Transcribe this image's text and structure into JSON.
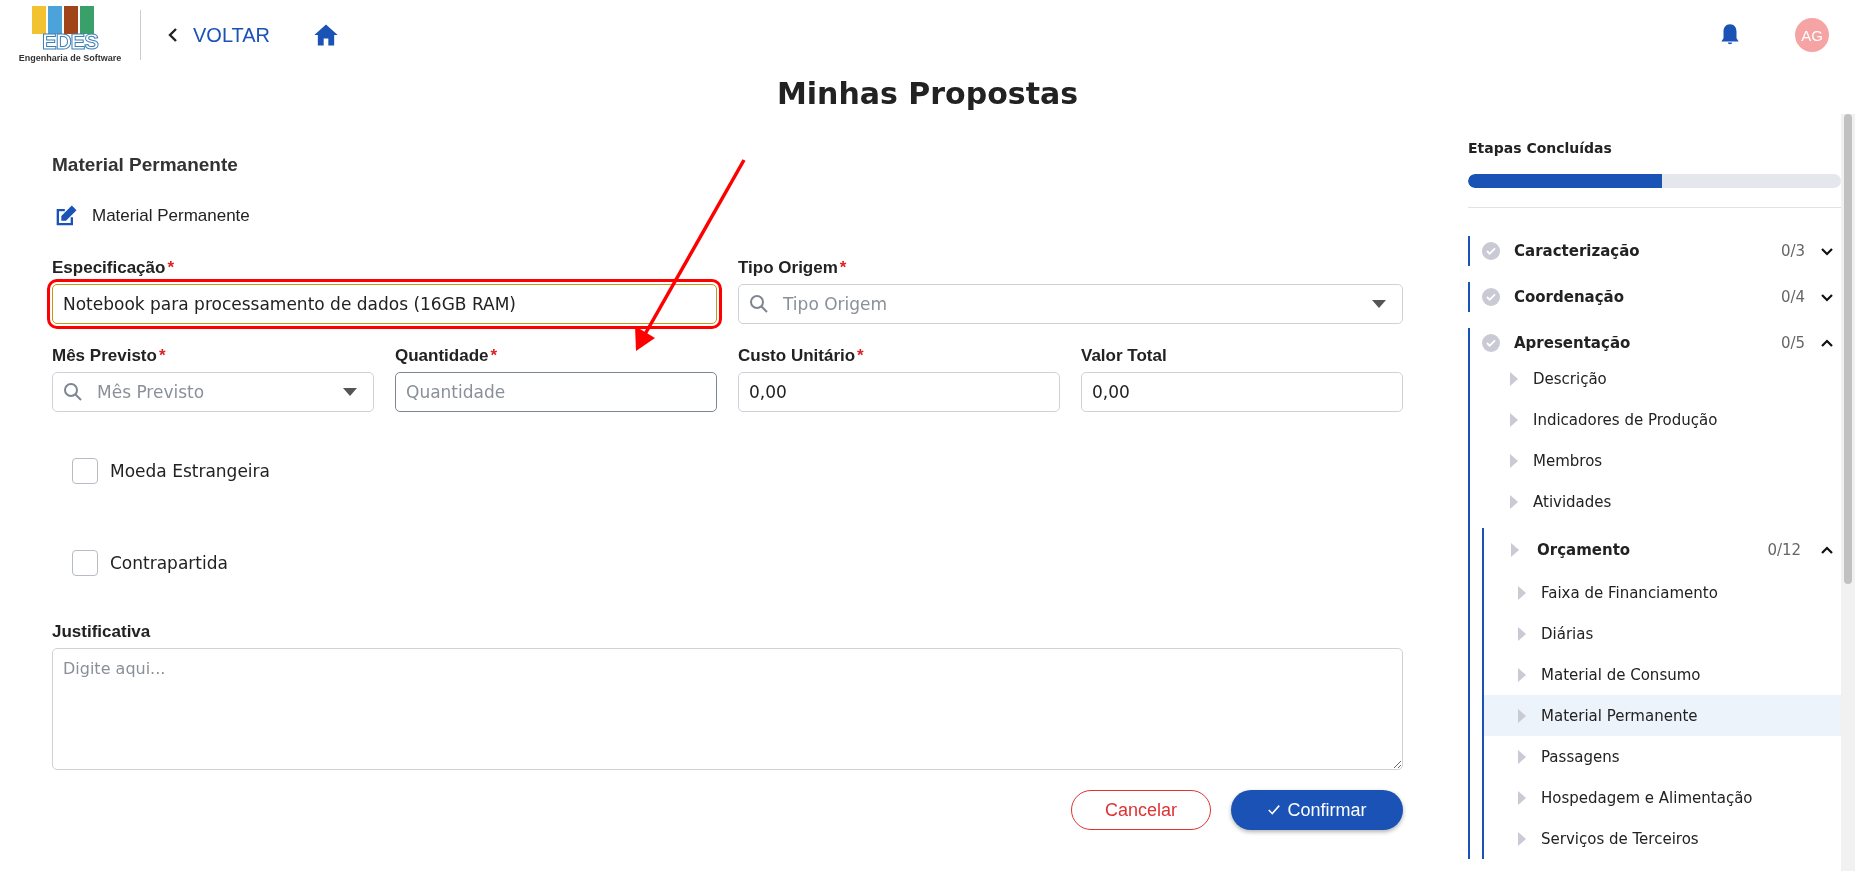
{
  "header": {
    "logo": {
      "text": "EDES",
      "subtitle": "Engenharia de Software"
    },
    "back": "VOLTAR",
    "avatar": "AG"
  },
  "title": "Minhas Propostas",
  "form": {
    "heading": "Material Permanente",
    "mode_label": "Material Permanente",
    "fields": [
      {
        "kind": "text",
        "label": "Especificação",
        "required_mark": "*",
        "value": "Notebook para processamento de dados (16GB RAM)",
        "highlighted": true
      },
      {
        "kind": "select",
        "label": "Tipo Origem",
        "required_mark": "*",
        "placeholder": "Tipo Origem",
        "highlighted": false
      },
      {
        "kind": "select",
        "label": "Mês Previsto",
        "required_mark": "*",
        "placeholder": "Mês Previsto",
        "highlighted": false
      },
      {
        "kind": "text",
        "label": "Quantidade",
        "required_mark": "*",
        "placeholder": "Quantidade",
        "highlighted": false
      },
      {
        "kind": "text",
        "label": "Custo Unitário",
        "required_mark": "*",
        "value": "0,00",
        "highlighted": false
      },
      {
        "kind": "text",
        "label": "Valor Total",
        "value": "0,00",
        "highlighted": false
      }
    ],
    "checkboxes": [
      {
        "label": "Moeda Estrangeira",
        "checked": false
      },
      {
        "label": "Contrapartida",
        "checked": false
      }
    ],
    "justificativa": {
      "label": "Justificativa",
      "placeholder": "Digite aqui..."
    },
    "buttons": {
      "cancel": "Cancelar",
      "confirm": "Confirmar"
    }
  },
  "sidebar": {
    "progress_label": "Etapas Concluídas",
    "level": 0.52,
    "sections": [
      {
        "label": "Caracterização",
        "count": "0/3",
        "expanded": false
      },
      {
        "label": "Coordenação",
        "count": "0/4",
        "expanded": false
      },
      {
        "label": "Apresentação",
        "count": "0/5",
        "expanded": true,
        "children": [
          {
            "label": "Descrição",
            "selected": false
          },
          {
            "label": "Indicadores de Produção",
            "selected": false
          },
          {
            "label": "Membros",
            "selected": false
          },
          {
            "label": "Atividades",
            "selected": false
          },
          {
            "label": "Orçamento",
            "count": "0/12",
            "expanded": true,
            "selected": false,
            "children": [
              {
                "label": "Faixa de Financiamento",
                "selected": false
              },
              {
                "label": "Diárias",
                "selected": false
              },
              {
                "label": "Material de Consumo",
                "selected": false
              },
              {
                "label": "Material Permanente",
                "selected": true
              },
              {
                "label": "Passagens",
                "selected": false
              },
              {
                "label": "Hospedagem e Alimentação",
                "selected": false
              },
              {
                "label": "Serviços de Terceiros",
                "selected": false
              }
            ]
          }
        ]
      }
    ]
  }
}
